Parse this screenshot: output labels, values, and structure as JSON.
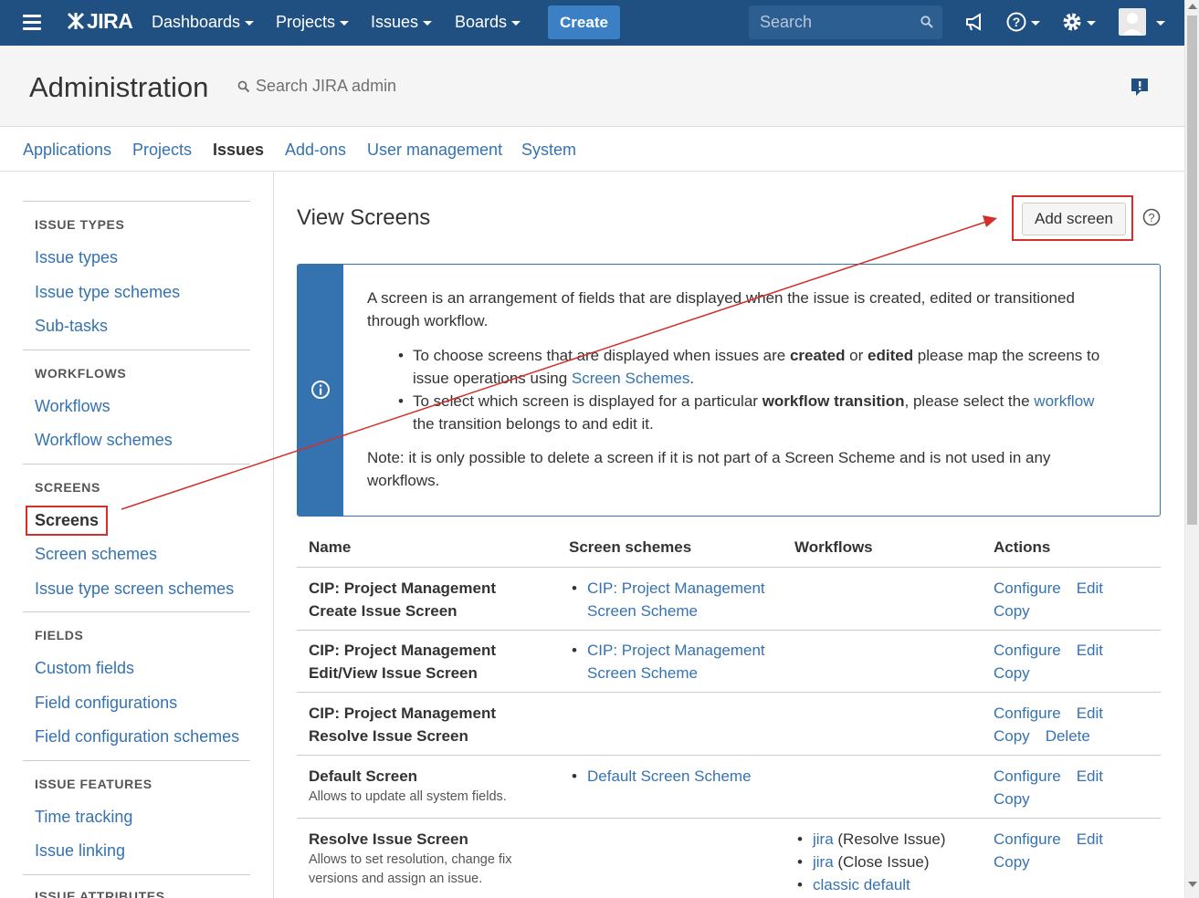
{
  "topnav": {
    "logo": "JIRA",
    "items": [
      "Dashboards",
      "Projects",
      "Issues",
      "Boards"
    ],
    "create_label": "Create",
    "search_placeholder": "Search",
    "icons": [
      "menu-icon",
      "megaphone-icon",
      "help-icon",
      "gear-icon",
      "avatar-icon"
    ]
  },
  "admin": {
    "title": "Administration",
    "search_placeholder": "Search JIRA admin"
  },
  "tabs": [
    "Applications",
    "Projects",
    "Issues",
    "Add-ons",
    "User management",
    "System"
  ],
  "active_tab": "Issues",
  "sidebar": {
    "sections": [
      {
        "heading": "ISSUE TYPES",
        "links": [
          "Issue types",
          "Issue type schemes",
          "Sub-tasks"
        ]
      },
      {
        "heading": "WORKFLOWS",
        "links": [
          "Workflows",
          "Workflow schemes"
        ]
      },
      {
        "heading": "SCREENS",
        "links": [
          "Screens",
          "Screen schemes",
          "Issue type screen schemes"
        ]
      },
      {
        "heading": "FIELDS",
        "links": [
          "Custom fields",
          "Field configurations",
          "Field configuration schemes"
        ]
      },
      {
        "heading": "ISSUE FEATURES",
        "links": [
          "Time tracking",
          "Issue linking"
        ]
      },
      {
        "heading": "ISSUE ATTRIBUTES",
        "links": []
      }
    ],
    "selected": "Screens"
  },
  "main": {
    "title": "View Screens",
    "add_button": "Add screen",
    "info": {
      "p1": "A screen is an arrangement of fields that are displayed when the issue is created, edited or transitioned through workflow.",
      "b1_a": "To choose screens that are displayed when issues are ",
      "b1_created": "created",
      "b1_or": " or ",
      "b1_edited": "edited",
      "b1_b": " please map the screens to issue operations using ",
      "b1_link": "Screen Schemes",
      "b1_end": ".",
      "b2_a": "To select which screen is displayed for a particular ",
      "b2_bold": "workflow transition",
      "b2_b": ", please select the ",
      "b2_link": "workflow",
      "b2_end": " the transition belongs to and edit it.",
      "note": "Note: it is only possible to delete a screen if it is not part of a Screen Scheme and is not used in any workflows."
    },
    "table": {
      "headers": [
        "Name",
        "Screen schemes",
        "Workflows",
        "Actions"
      ],
      "rows": [
        {
          "name": "CIP: Project Management Create Issue Screen",
          "desc": "",
          "schemes": [
            "CIP: Project Management Screen Scheme"
          ],
          "workflows": [],
          "actions": [
            "Configure",
            "Edit",
            "Copy"
          ]
        },
        {
          "name": "CIP: Project Management Edit/View Issue Screen",
          "desc": "",
          "schemes": [
            "CIP: Project Management Screen Scheme"
          ],
          "workflows": [],
          "actions": [
            "Configure",
            "Edit",
            "Copy"
          ]
        },
        {
          "name": "CIP: Project Management Resolve Issue Screen",
          "desc": "",
          "schemes": [],
          "workflows": [],
          "actions": [
            "Configure",
            "Edit",
            "Copy",
            "Delete"
          ]
        },
        {
          "name": "Default Screen",
          "desc": "Allows to update all system fields.",
          "schemes": [
            "Default Screen Scheme"
          ],
          "workflows": [],
          "actions": [
            "Configure",
            "Edit",
            "Copy"
          ]
        },
        {
          "name": "Resolve Issue Screen",
          "desc": "Allows to set resolution, change fix versions and assign an issue.",
          "schemes": [],
          "workflows": [
            {
              "link": "jira",
              "suffix": " (Resolve Issue)"
            },
            {
              "link": "jira",
              "suffix": " (Close Issue)"
            },
            {
              "link": "classic default",
              "suffix": ""
            }
          ],
          "actions": [
            "Configure",
            "Edit",
            "Copy"
          ]
        }
      ]
    }
  },
  "colors": {
    "nav_bg": "#205081",
    "link": "#3572b0",
    "create_btn": "#3b7fc4",
    "annotation": "#d0312d"
  }
}
